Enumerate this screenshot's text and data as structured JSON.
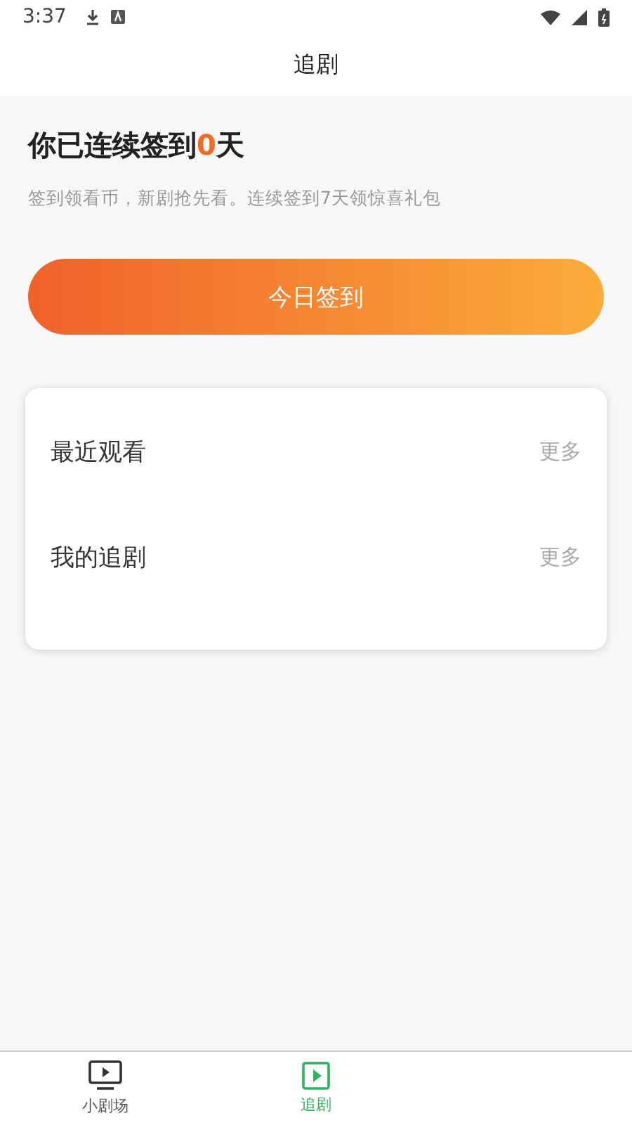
{
  "status_bar": {
    "time": "3:37"
  },
  "header": {
    "title": "追剧"
  },
  "checkin": {
    "title_before": "你已连续签到",
    "days": "0",
    "title_after": "天",
    "subtitle": "签到领看币，新剧抢先看。连续签到7天领惊喜礼包",
    "button": "今日签到"
  },
  "sections": [
    {
      "title": "最近观看",
      "more": "更多"
    },
    {
      "title": "我的追剧",
      "more": "更多"
    }
  ],
  "bottom_nav": [
    {
      "label": "小剧场",
      "kind": "tv",
      "selected": false
    },
    {
      "label": "追剧",
      "kind": "play",
      "selected": true
    }
  ]
}
